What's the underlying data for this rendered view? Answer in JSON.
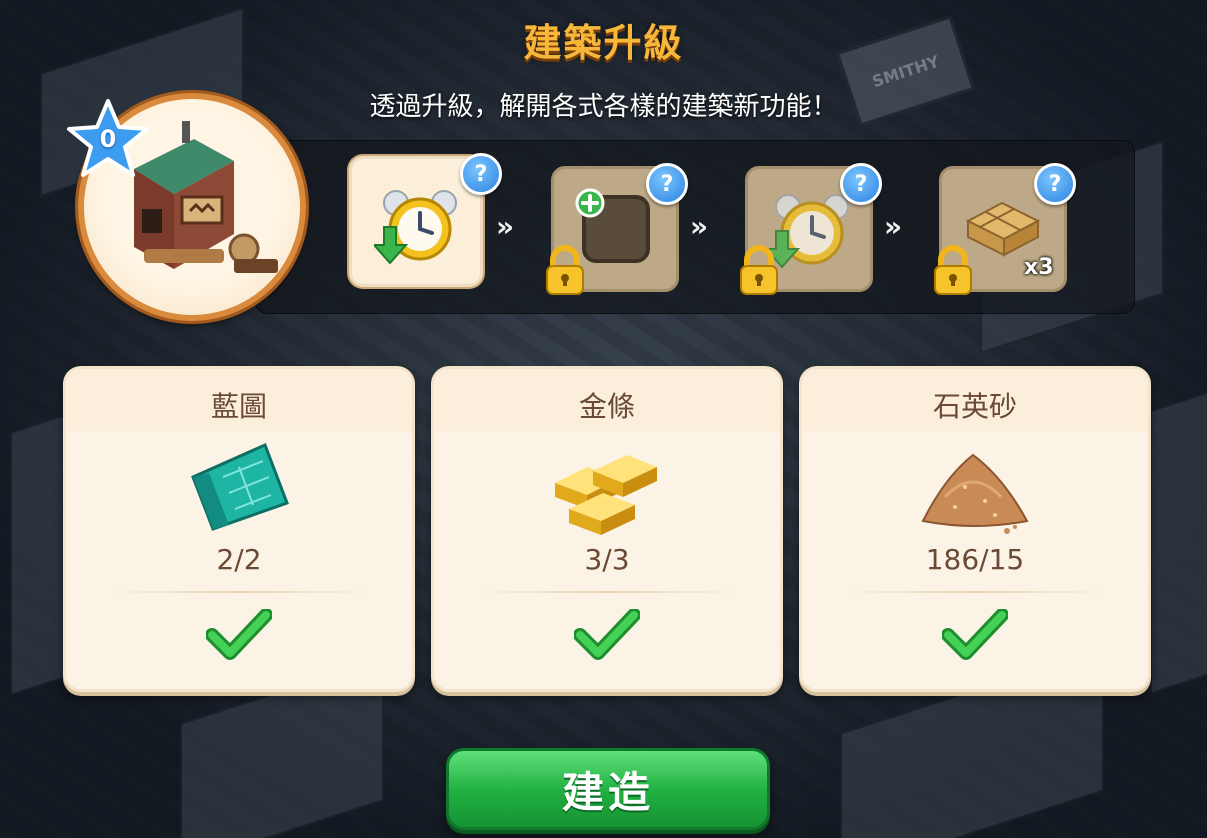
{
  "header": {
    "title": "建築升級",
    "subtitle": "透過升級，解開各式各樣的建築新功能！"
  },
  "building": {
    "level": "0",
    "icon": "sawmill-building-icon"
  },
  "upgrades": [
    {
      "icon": "alarm-clock-speedup-icon",
      "state": "unlocked"
    },
    {
      "icon": "add-slot-icon",
      "state": "locked"
    },
    {
      "icon": "alarm-clock-speedup-icon",
      "state": "locked"
    },
    {
      "icon": "planks-stack-icon",
      "state": "locked",
      "count": "x3"
    }
  ],
  "requirements": [
    {
      "name": "藍圖",
      "quantity": "2/2",
      "icon": "blueprint-icon",
      "met": true
    },
    {
      "name": "金條",
      "quantity": "3/3",
      "icon": "gold-bar-icon",
      "met": true
    },
    {
      "name": "石英砂",
      "quantity": "186/15",
      "icon": "quartz-sand-icon",
      "met": true
    }
  ],
  "actions": {
    "build_label": "建造"
  },
  "colors": {
    "title": "#f6b73a",
    "button_green": "#1fae3f",
    "badge_blue": "#2b82e0",
    "card_bg": "#fbf3e6"
  }
}
